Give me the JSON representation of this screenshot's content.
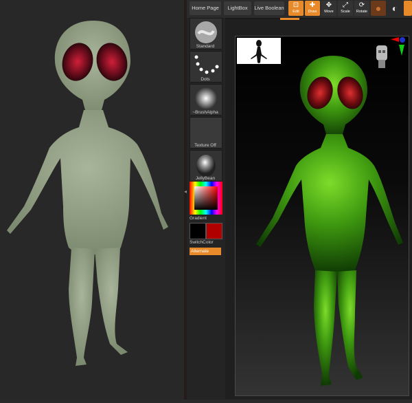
{
  "top_bar": {
    "tabs": [
      "Home Page",
      "LightBox",
      "Live Boolean"
    ],
    "tools": [
      {
        "label": "Edit",
        "icon": "edit-icon",
        "active": true
      },
      {
        "label": "Draw",
        "icon": "draw-icon",
        "active": true
      },
      {
        "label": "Move",
        "icon": "move-icon",
        "active": false
      },
      {
        "label": "Scale",
        "icon": "scale-icon",
        "active": false
      },
      {
        "label": "Rotate",
        "icon": "rotate-icon",
        "active": false
      }
    ],
    "accent_color": "#e88a2a"
  },
  "shelf": {
    "items": [
      {
        "label": "Standard",
        "icon": "standard-brush-icon"
      },
      {
        "label": "Dots",
        "icon": "dots-stroke-icon"
      },
      {
        "label": "~BrushAlpha",
        "icon": "brush-alpha-icon"
      },
      {
        "label": "Texture Off",
        "icon": "texture-off-icon"
      },
      {
        "label": "JellyBean",
        "icon": "jellybean-material-icon"
      }
    ],
    "gradient_label": "Gradient",
    "switch_color_label": "SwitchColor",
    "alternate_label": "Alternate",
    "primary_color": "#000000",
    "secondary_color": "#b00000"
  }
}
